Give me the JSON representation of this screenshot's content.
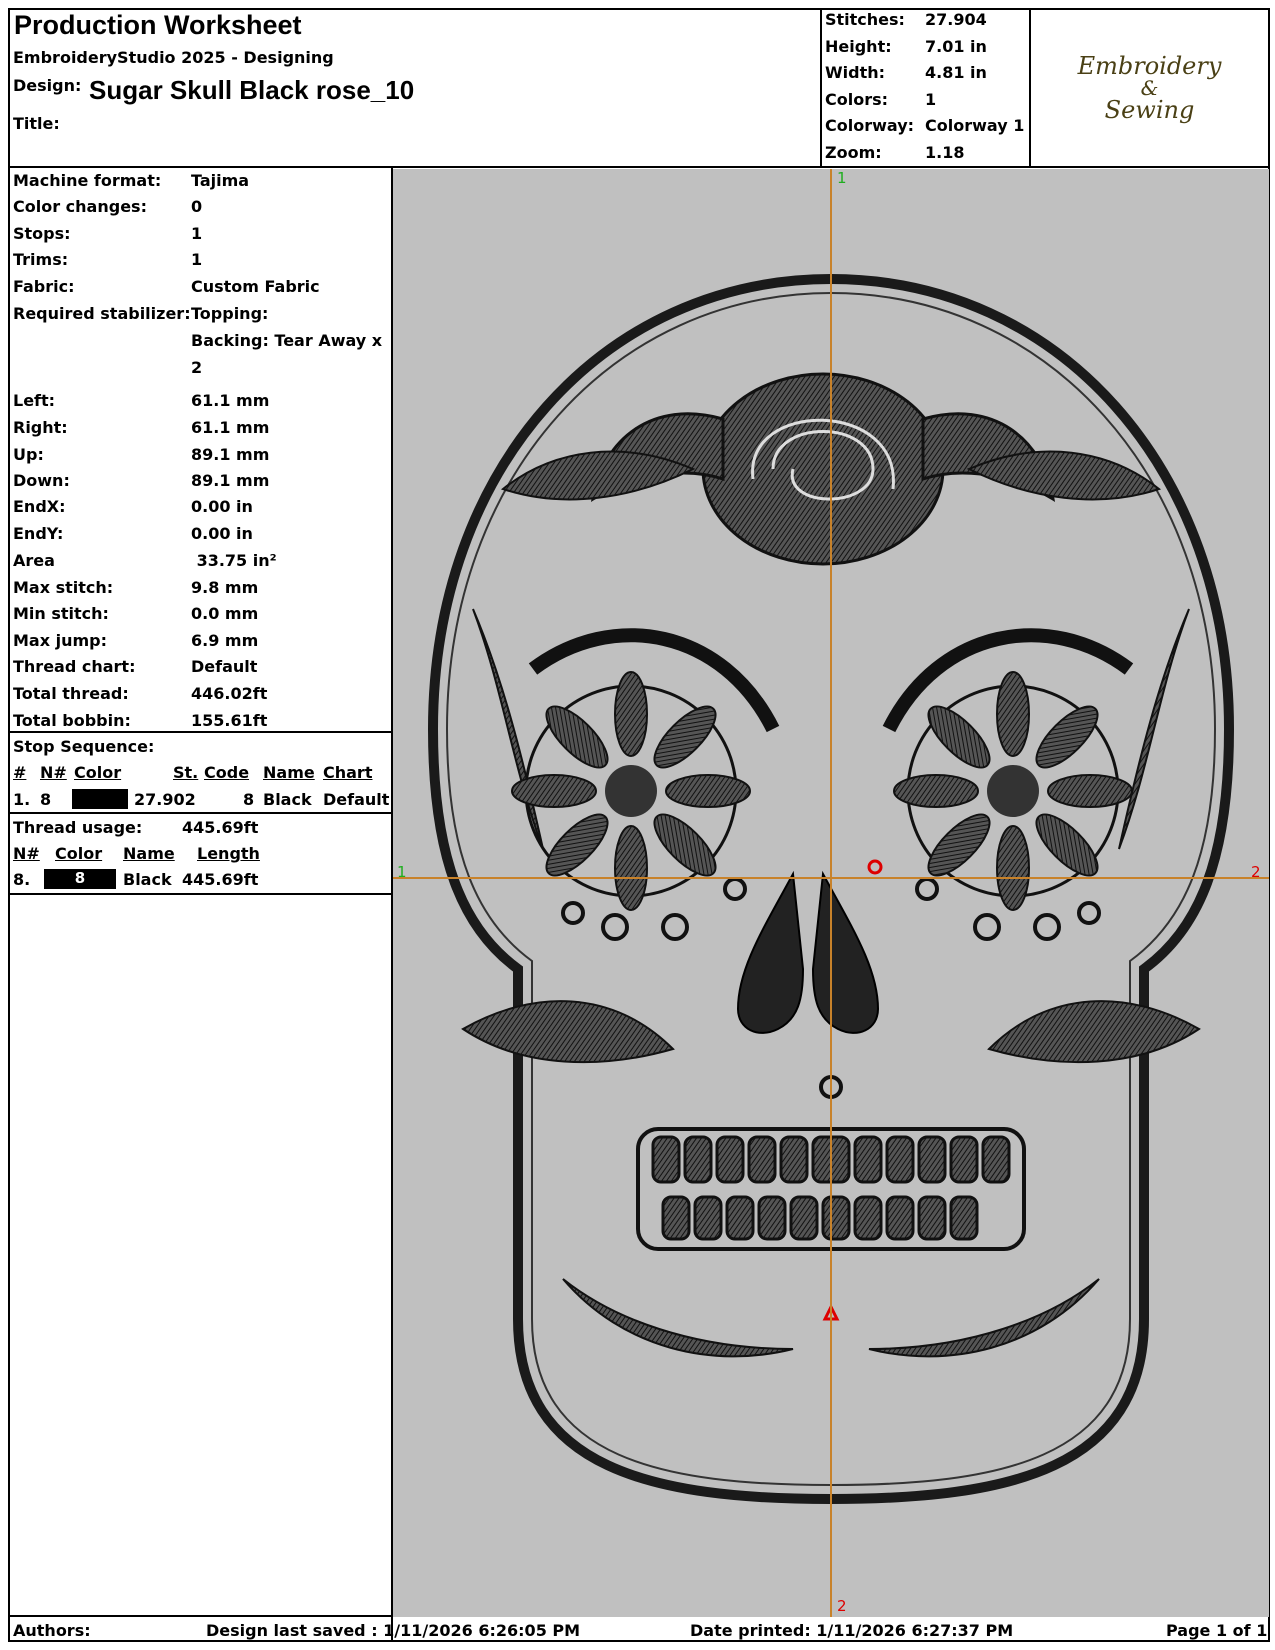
{
  "header": {
    "title": "Production Worksheet",
    "software": "EmbroideryStudio 2025 - Designing",
    "design_label": "Design:",
    "design_value": "Sugar Skull Black rose_10",
    "title_label": "Title:",
    "title_value": ""
  },
  "summary": [
    {
      "label": "Stitches:",
      "value": "27.904"
    },
    {
      "label": "Height:",
      "value": "7.01 in"
    },
    {
      "label": "Width:",
      "value": "4.81 in"
    },
    {
      "label": "Colors:",
      "value": "1"
    },
    {
      "label": "Colorway:",
      "value": "Colorway 1"
    },
    {
      "label": "Zoom:",
      "value": "1.18"
    }
  ],
  "logo": {
    "line1": "Embroidery",
    "line2": "&",
    "line3": "Sewing"
  },
  "specs": [
    {
      "label": "Machine format:",
      "value": "Tajima"
    },
    {
      "label": "Color changes:",
      "value": "0"
    },
    {
      "label": "Stops:",
      "value": "1"
    },
    {
      "label": "Trims:",
      "value": "1"
    },
    {
      "label": "Fabric:",
      "value": "Custom Fabric"
    },
    {
      "label": "Required stabilizer:",
      "value": "Topping:"
    },
    {
      "label": "",
      "value": "Backing: Tear Away x"
    },
    {
      "label": "",
      "value": "2"
    },
    {
      "label": "Left:",
      "value": "61.1 mm"
    },
    {
      "label": "Right:",
      "value": "61.1 mm"
    },
    {
      "label": "Up:",
      "value": "89.1 mm"
    },
    {
      "label": "Down:",
      "value": "89.1 mm"
    },
    {
      "label": "EndX:",
      "value": "0.00 in"
    },
    {
      "label": "EndY:",
      "value": "0.00 in"
    },
    {
      "label": "Area",
      "value": " 33.75 in²"
    },
    {
      "label": "Max stitch:",
      "value": "9.8 mm"
    },
    {
      "label": "Min stitch:",
      "value": "0.0 mm"
    },
    {
      "label": "Max jump:",
      "value": "6.9 mm"
    },
    {
      "label": "Thread chart:",
      "value": "Default"
    },
    {
      "label": "Total thread:",
      "value": "446.02ft"
    },
    {
      "label": "Total bobbin:",
      "value": "155.61ft"
    }
  ],
  "stop_sequence": {
    "title": "Stop Sequence:",
    "headers": {
      "num": "#",
      "n": "N#",
      "color": "Color",
      "st": "St.",
      "code": "Code",
      "name": "Name",
      "chart": "Chart"
    },
    "rows": [
      {
        "num": "1.",
        "n": "8",
        "st": "27.902",
        "code": "8",
        "name": "Black",
        "chart": "Default"
      }
    ]
  },
  "thread_usage": {
    "title": "Thread usage:",
    "total": "445.69ft",
    "headers": {
      "n": "N#",
      "color": "Color",
      "name": "Name",
      "length": "Length"
    },
    "rows": [
      {
        "n": "8.",
        "swatch": "8",
        "name": "Black",
        "length": "445.69ft"
      }
    ]
  },
  "canvas": {
    "guide_top": "1",
    "guide_bottom": "2",
    "guide_left": "1",
    "guide_right": "2",
    "background": "#c0c0c0",
    "guide_color": "#c8822a"
  },
  "footer": {
    "authors": "Authors:",
    "saved": "Design last saved : 1/11/2026 6:26:05 PM",
    "printed": "Date printed: 1/11/2026 6:27:37 PM",
    "page": "Page 1 of 1"
  }
}
